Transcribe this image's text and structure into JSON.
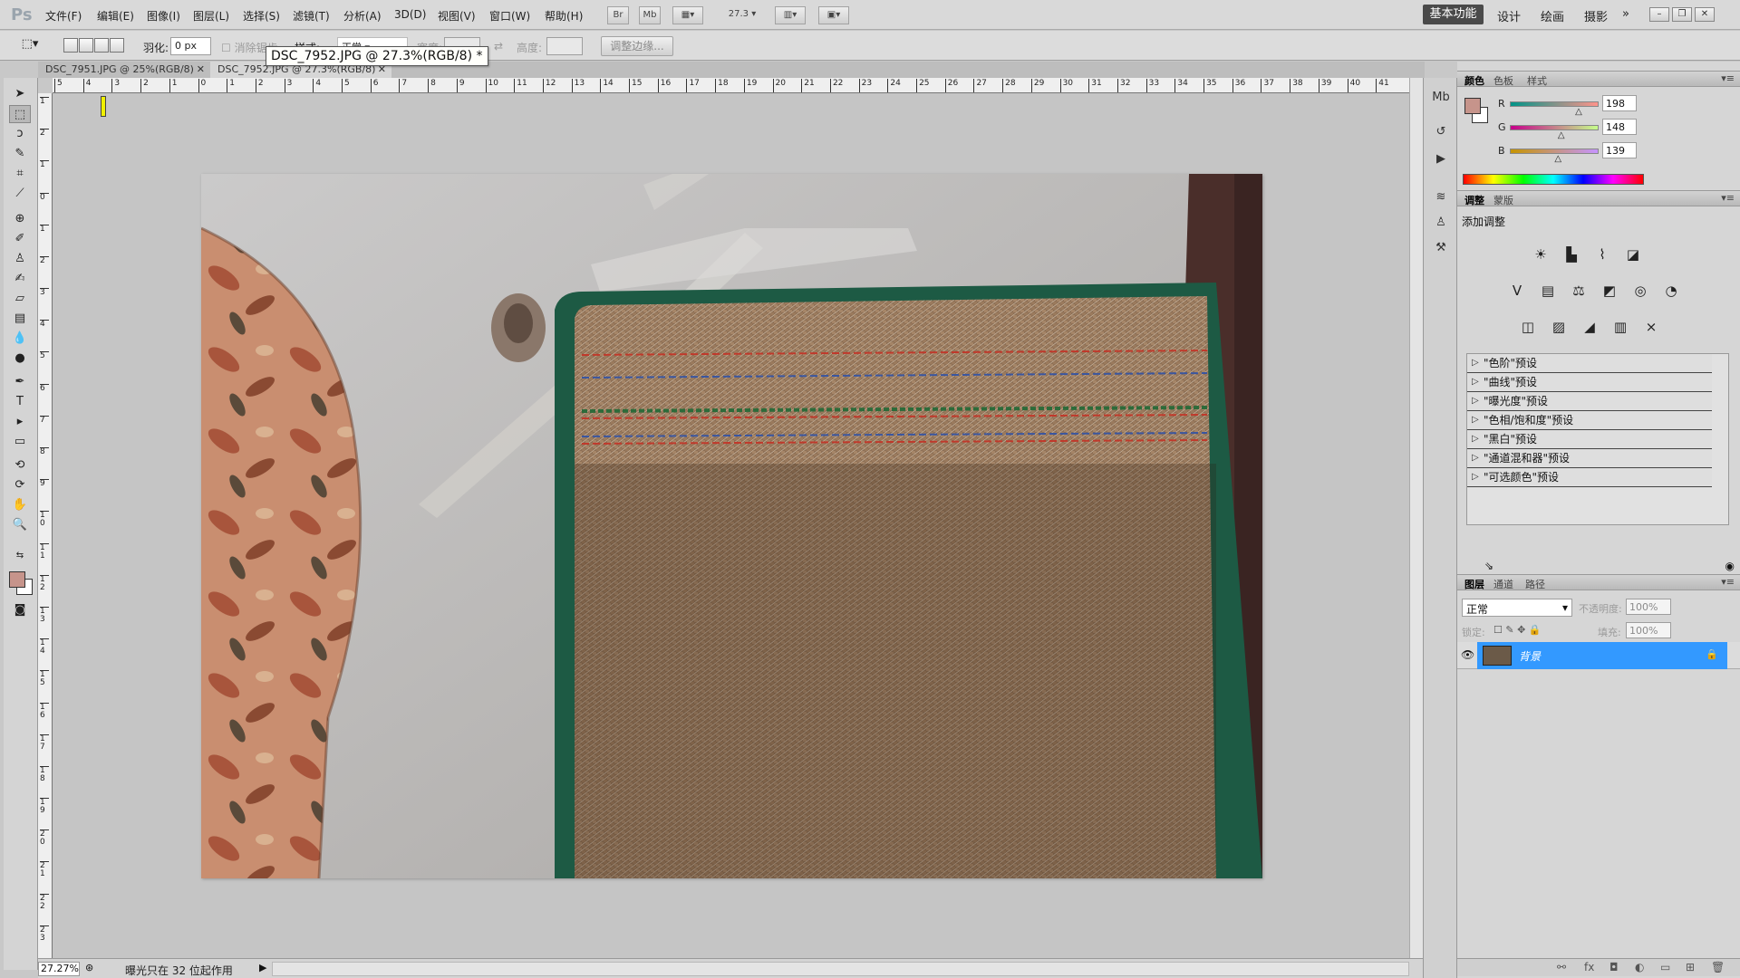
{
  "app": {
    "logo": "Ps"
  },
  "menu": [
    "文件(F)",
    "编辑(E)",
    "图像(I)",
    "图层(L)",
    "选择(S)",
    "滤镜(T)",
    "分析(A)",
    "3D(D)",
    "视图(V)",
    "窗口(W)",
    "帮助(H)"
  ],
  "toolbar": {
    "bridge": "Br",
    "minibridge": "Mb",
    "zoom": "27.3"
  },
  "workspaces": {
    "active": "基本功能",
    "others": [
      "设计",
      "绘画",
      "摄影"
    ],
    "more": "»"
  },
  "window_controls": [
    "–",
    "❐",
    "✕"
  ],
  "options": {
    "feather_label": "羽化:",
    "feather_value": "0 px",
    "antialias_label": "消除锯齿",
    "style_label": "样式:",
    "style_value": "正常",
    "width_label": "宽度:",
    "height_label": "高度:",
    "refine_edge": "调整边缘..."
  },
  "tooltip": "DSC_7952.JPG @ 27.3%(RGB/8) *",
  "tabs": [
    {
      "label": "DSC_7951.JPG @ 25%(RGB/8)",
      "close": "✕"
    },
    {
      "label": "DSC_7952.JPG @ 27.3%(RGB/8)",
      "close": "✕"
    }
  ],
  "ruler": {
    "top_labels": [
      "5",
      "4",
      "3",
      "2",
      "1",
      "0",
      "1",
      "2",
      "3",
      "4",
      "5",
      "6",
      "7",
      "8",
      "9",
      "10",
      "11",
      "12",
      "13",
      "14",
      "15",
      "16",
      "17",
      "18",
      "19",
      "20",
      "21",
      "22",
      "23",
      "24",
      "25",
      "26",
      "27",
      "28",
      "29",
      "30",
      "31",
      "32",
      "33",
      "34",
      "35",
      "36",
      "37",
      "38",
      "39",
      "40",
      "41"
    ],
    "left_labels": [
      "1",
      "2",
      "1",
      "0",
      "1",
      "2",
      "3",
      "4",
      "5",
      "6",
      "7",
      "8",
      "9",
      "10",
      "11",
      "12",
      "13",
      "14",
      "15",
      "16",
      "17",
      "18",
      "19",
      "20",
      "21",
      "22",
      "23"
    ]
  },
  "status": {
    "zoom": "27.27%",
    "message": "曝光只在 32 位起作用",
    "arrow": "▶"
  },
  "color_panel": {
    "tabs": [
      "颜色",
      "色板",
      "样式"
    ],
    "r_label": "R",
    "g_label": "G",
    "b_label": "B",
    "r": 198,
    "g": 148,
    "b": 139,
    "foreground": "#c6948b"
  },
  "adjust_panel": {
    "tabs": [
      "调整",
      "蒙版"
    ],
    "title": "添加调整",
    "presets": [
      "\"色阶\"预设",
      "\"曲线\"预设",
      "\"曝光度\"预设",
      "\"色相/饱和度\"预设",
      "\"黑白\"预设",
      "\"通道混和器\"预设",
      "\"可选颜色\"预设"
    ]
  },
  "layers_panel": {
    "tabs": [
      "图层",
      "通道",
      "路径"
    ],
    "blend_mode": "正常",
    "opacity_label": "不透明度:",
    "opacity_value": "100%",
    "lock_label": "锁定:",
    "fill_label": "填充:",
    "fill_value": "100%",
    "layer_name": "背景",
    "selected_color": "#3399ff"
  }
}
